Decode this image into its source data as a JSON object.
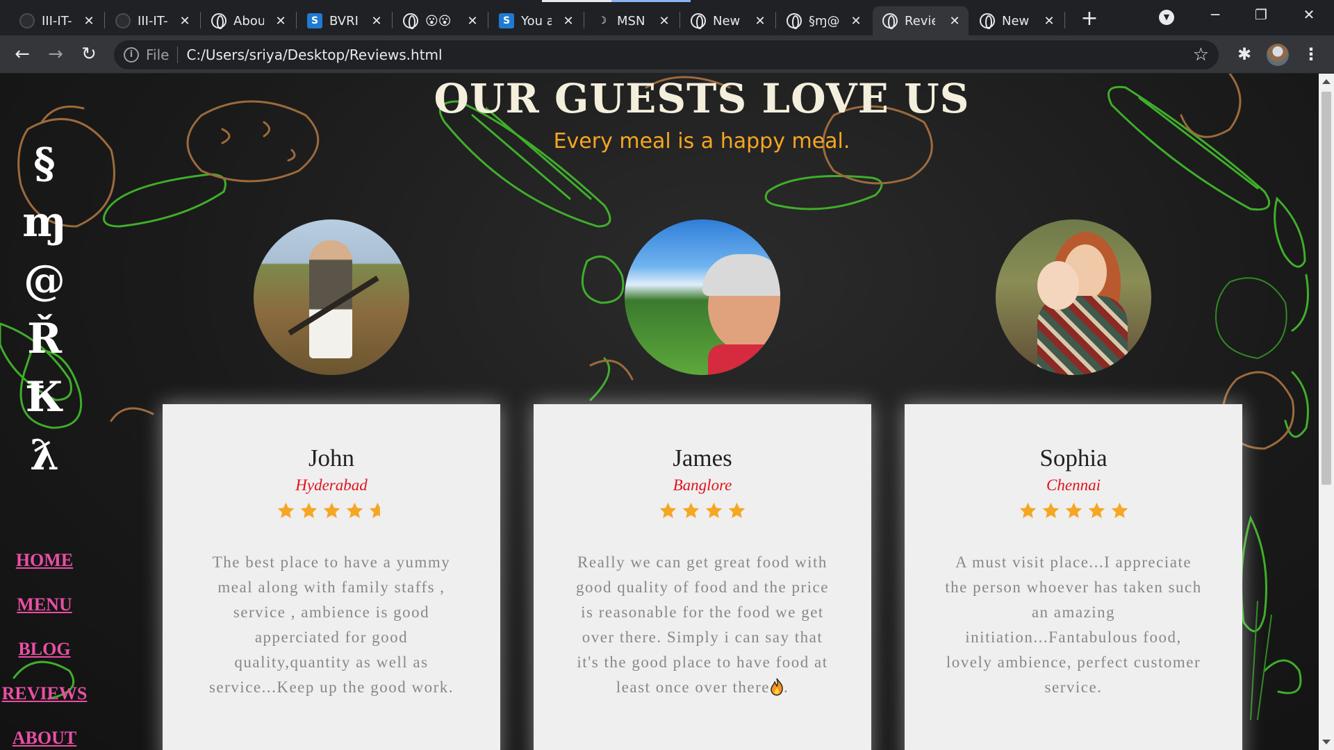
{
  "browser": {
    "tabs": [
      {
        "title": "III-IT-",
        "icon": "github-icon"
      },
      {
        "title": "III-IT-",
        "icon": "github-icon"
      },
      {
        "title": "Abou",
        "icon": "globe-icon"
      },
      {
        "title": "BVRI",
        "icon": "s-brand-icon"
      },
      {
        "title": "😮😮",
        "icon": "globe-icon"
      },
      {
        "title": "You a",
        "icon": "s-brand-icon"
      },
      {
        "title": "MSN",
        "icon": "msn-icon"
      },
      {
        "title": "New",
        "icon": "globe-icon"
      },
      {
        "title": "§ɱ@",
        "icon": "globe-icon"
      },
      {
        "title": "Revie",
        "icon": "globe-icon",
        "active": true
      },
      {
        "title": "New",
        "icon": "globe-icon"
      }
    ],
    "address_scheme": "File",
    "address_url": "C:/Users/sriya/Desktop/Reviews.html"
  },
  "page": {
    "title": "OUR GUESTS LOVE US",
    "subtitle": "Every meal is a happy meal.",
    "logo_letters": [
      "§",
      "ɱ",
      "@",
      "Ř",
      "Ꝁ",
      "ƛ"
    ],
    "nav": [
      "HOME",
      "MENU",
      "BLOG",
      "REVIEWS",
      "ABOUT"
    ],
    "reviews": [
      {
        "name": "John",
        "city": "Hyderabad",
        "rating": 4.5,
        "text": "The best place to have a yummy meal along with family staffs , service , ambience is good apperciated for good quality,quantity as well as service...Keep up the good work."
      },
      {
        "name": "James",
        "city": "Banglore",
        "rating": 4,
        "text": "Really we can get great food with good quality of food and the price is reasonable for the food we get over there. Simply i can say that it's the good place to have food at least once over there"
      },
      {
        "name": "Sophia",
        "city": "Chennai",
        "rating": 5,
        "text": "A must visit place...I appreciate the person whoever has taken such an amazing initiation...Fantabulous food, lovely ambience, perfect customer service."
      }
    ]
  },
  "colors": {
    "title": "#f4eedc",
    "subtitle": "#f5a623",
    "nav_link": "#e94fa4",
    "city": "#e0121b",
    "star": "#f5a623",
    "review_text": "#888888"
  }
}
